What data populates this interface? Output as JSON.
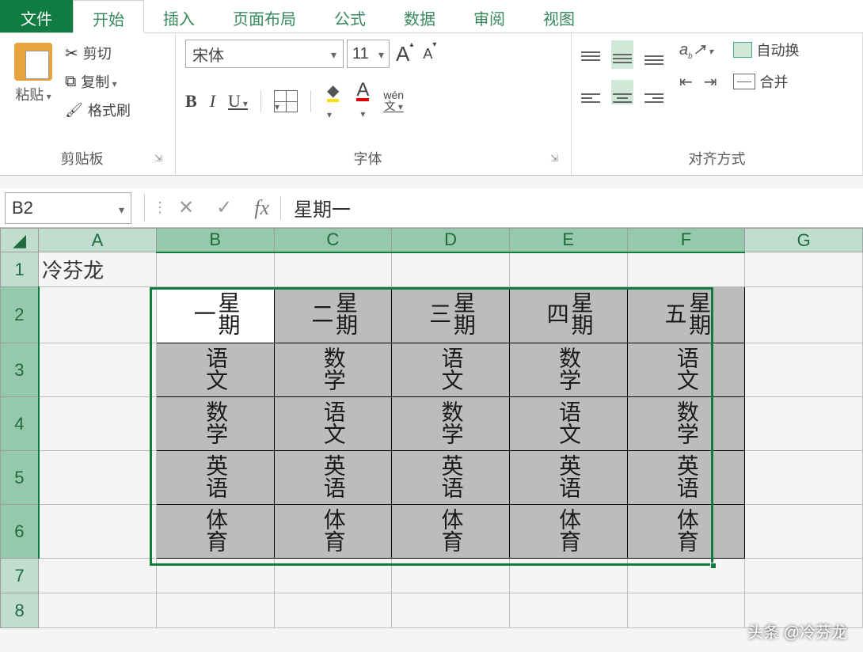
{
  "tabs": {
    "file": "文件",
    "home": "开始",
    "insert": "插入",
    "layout": "页面布局",
    "formula": "公式",
    "data": "数据",
    "review": "审阅",
    "view": "视图"
  },
  "clipboard": {
    "paste": "粘贴",
    "cut": "剪切",
    "copy": "复制",
    "format_painter": "格式刷",
    "group": "剪贴板"
  },
  "font": {
    "name": "宋体",
    "size": "11",
    "group": "字体",
    "bold": "B",
    "italic": "I",
    "underline": "U",
    "pinyin": "wén",
    "pinyin_sub": "文",
    "fontcolor_letter": "A",
    "bigA_letter": "A",
    "smallA_letter": "A"
  },
  "align": {
    "group": "对齐方式",
    "wrap": "自动换",
    "merge": "合并"
  },
  "formula_bar": {
    "name_box": "B2",
    "value": "星期一",
    "fx": "fx"
  },
  "columns": [
    "A",
    "B",
    "C",
    "D",
    "E",
    "F",
    "G"
  ],
  "row_numbers": [
    "1",
    "2",
    "3",
    "4",
    "5",
    "6",
    "7",
    "8"
  ],
  "cells": {
    "A1": "冷芬龙",
    "r2": [
      "星期一",
      "星期二",
      "星期三",
      "星期四",
      "星期五"
    ],
    "r2_vis": [
      "期",
      "期",
      "期",
      "期",
      "期"
    ],
    "r3": [
      "语文",
      "数学",
      "语文",
      "数学",
      "语文"
    ],
    "r4": [
      "数学",
      "语文",
      "数学",
      "语文",
      "数学"
    ],
    "r5": [
      "英语",
      "英语",
      "英语",
      "英语",
      "英语"
    ],
    "r6": [
      "体育",
      "体育",
      "体育",
      "体育",
      "体育"
    ]
  },
  "watermark": "头条 @冷芬龙"
}
